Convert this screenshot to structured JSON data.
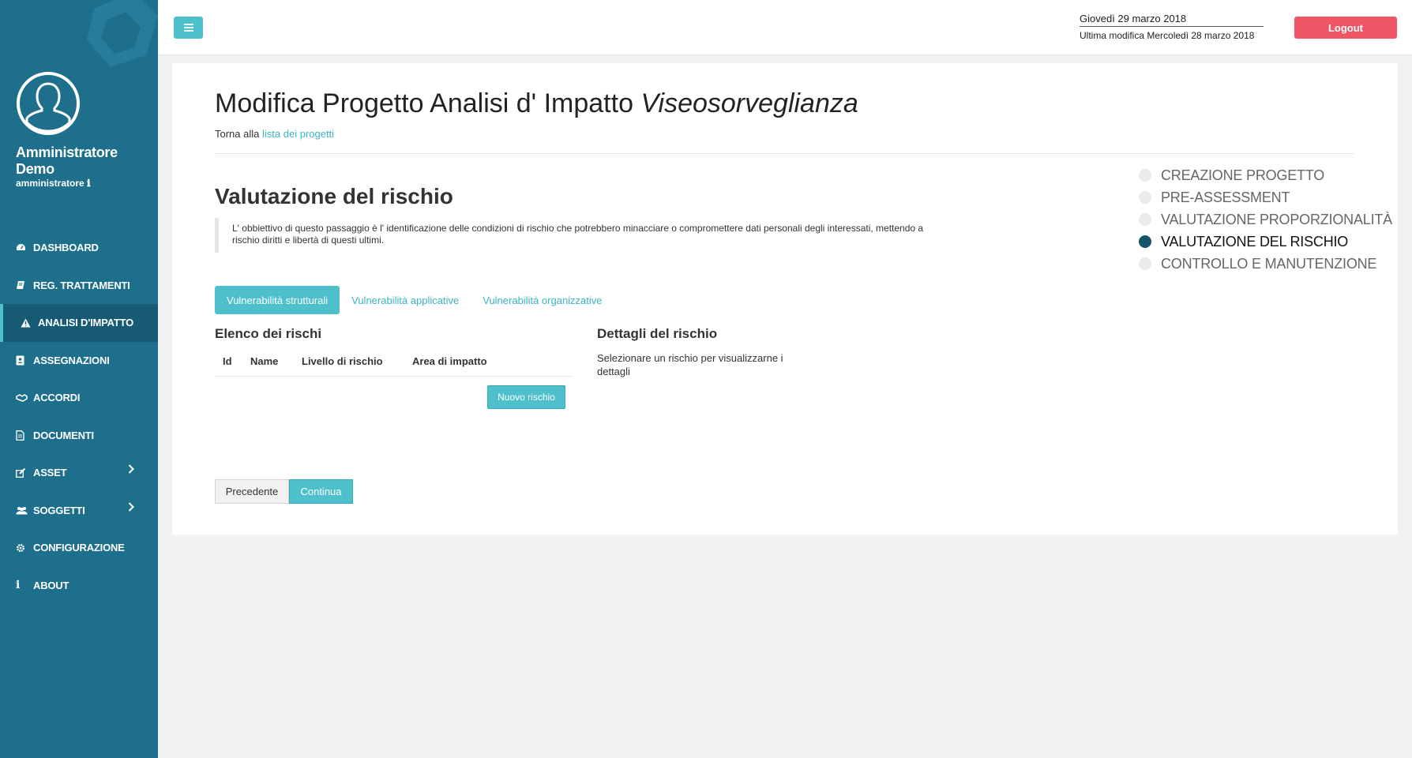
{
  "user": {
    "name": "Amministratore Demo",
    "role": "amministratore",
    "role_icon": "info-icon"
  },
  "sidebar": {
    "items": [
      {
        "label": "DASHBOARD",
        "icon": "dashboard-icon"
      },
      {
        "label": "REG. TRATTAMENTI",
        "icon": "book-icon"
      },
      {
        "label": "ANALISI D'IMPATTO",
        "icon": "warning-icon",
        "active": true
      },
      {
        "label": "ASSEGNAZIONI",
        "icon": "badge-icon"
      },
      {
        "label": "ACCORDI",
        "icon": "handshake-icon"
      },
      {
        "label": "DOCUMENTI",
        "icon": "document-icon"
      },
      {
        "label": "ASSET",
        "icon": "edit-icon",
        "has_submenu": true
      },
      {
        "label": "SOGGETTI",
        "icon": "users-icon",
        "has_submenu": true
      },
      {
        "label": "CONFIGURAZIONE",
        "icon": "gear-icon"
      },
      {
        "label": "ABOUT",
        "icon": "info-icon"
      }
    ]
  },
  "header": {
    "today": "Giovedì 29 marzo 2018",
    "last_modified": "Ultima modifica Mercoledì 28 marzo 2018",
    "logout_label": "Logout"
  },
  "page": {
    "title_prefix": "Modifica Progetto Analisi d' Impatto",
    "title_project": "Viseosorveglianza",
    "back_text": "Torna alla",
    "back_link": "lista dei progetti",
    "section_title": "Valutazione del rischio",
    "description": "L' obbiettivo di questo passaggio è l' identificazione delle condizioni di rischio che potrebbero minacciare o compromettere dati personali degli interessati, mettendo a rischio diritti e libertà di questi ultimi."
  },
  "tabs": [
    {
      "label": "Vulnerabilità strutturali",
      "active": true
    },
    {
      "label": "Vulnerabilità applicative",
      "active": false
    },
    {
      "label": "Vulnerabilità organizzative",
      "active": false
    }
  ],
  "risk_list": {
    "title": "Elenco dei rischi",
    "columns": [
      "Id",
      "Name",
      "Livello di rischio",
      "Area di impatto"
    ],
    "rows": [],
    "new_button": "Nuovo rischio"
  },
  "risk_details": {
    "title": "Dettagli del rischio",
    "placeholder": "Selezionare un rischio per visualizzarne i dettagli"
  },
  "navigation": {
    "prev_label": "Precedente",
    "next_label": "Continua"
  },
  "steps": [
    {
      "label": "CREAZIONE PROGETTO",
      "current": false
    },
    {
      "label": "PRE-ASSESSMENT",
      "current": false
    },
    {
      "label": "VALUTAZIONE PROPORZIONALITÀ",
      "current": false
    },
    {
      "label": "VALUTAZIONE DEL RISCHIO",
      "current": true
    },
    {
      "label": "CONTROLLO E MANUTENZIONE",
      "current": false
    }
  ],
  "colors": {
    "sidebar": "#1e6f8c",
    "accent": "#4ec0cc",
    "logout": "#ee5565",
    "step_current": "#16536b"
  }
}
